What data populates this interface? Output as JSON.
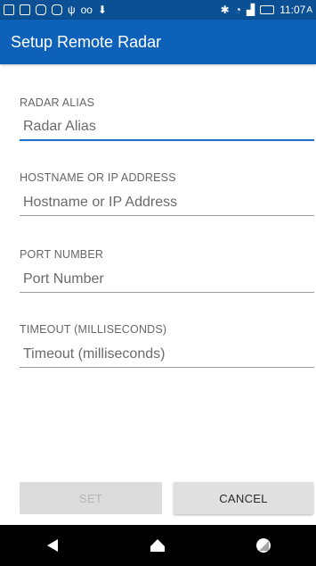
{
  "status_bar": {
    "time": "11:07",
    "time_suffix": "A"
  },
  "app_bar": {
    "title": "Setup Remote Radar"
  },
  "form": {
    "fields": [
      {
        "label": "RADAR ALIAS",
        "placeholder": "Radar Alias",
        "value": ""
      },
      {
        "label": "HOSTNAME OR IP ADDRESS",
        "placeholder": "Hostname or IP Address",
        "value": ""
      },
      {
        "label": "PORT NUMBER",
        "placeholder": "Port Number",
        "value": ""
      },
      {
        "label": "TIMEOUT (MILLISECONDS)",
        "placeholder": "Timeout (milliseconds)",
        "value": ""
      }
    ]
  },
  "buttons": {
    "set_label": "SET",
    "cancel_label": "CANCEL"
  },
  "icons": {
    "status_left": [
      "image-icon",
      "image-icon",
      "instagram-icon",
      "instagram-icon",
      "usb-icon",
      "voicemail-icon",
      "download-icon"
    ],
    "status_right": [
      "bluetooth-icon",
      "wifi-icon",
      "signal-icon",
      "battery-icon"
    ],
    "nav": [
      "back-icon",
      "home-icon",
      "recents-icon"
    ]
  },
  "colors": {
    "status_bar": "#0b4f94",
    "app_bar": "#0e61b8",
    "accent": "#1a73c9"
  }
}
